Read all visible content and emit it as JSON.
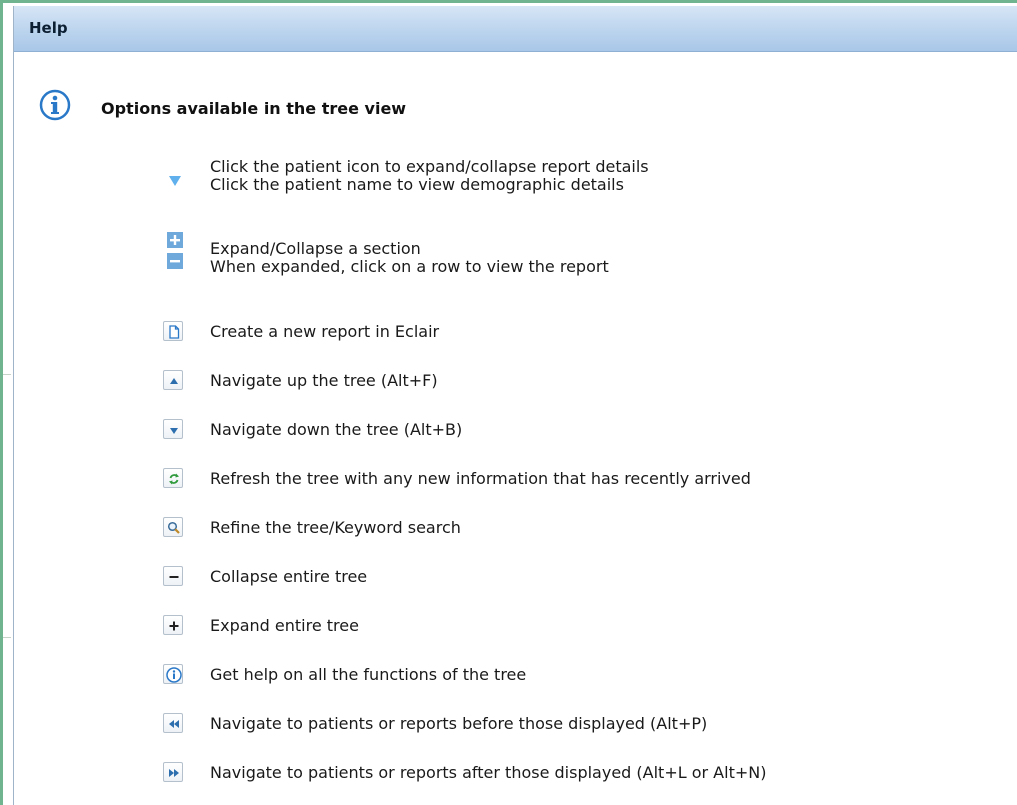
{
  "panel": {
    "title": "Help",
    "heading": "Options available in the tree view"
  },
  "patient": {
    "line1": "Click the patient icon to expand/collapse report details",
    "line2": "Click the patient name to view demographic details"
  },
  "section": {
    "line1": "Expand/Collapse a section",
    "line2": "When expanded, click on a row to view the report"
  },
  "items": [
    {
      "icon": "new-report-icon",
      "text": "Create a new report in Eclair"
    },
    {
      "icon": "navigate-up-icon",
      "text": "Navigate up the tree (Alt+F)"
    },
    {
      "icon": "navigate-down-icon",
      "text": "Navigate down the tree (Alt+B)"
    },
    {
      "icon": "refresh-icon",
      "text": "Refresh the tree with any new information that has recently arrived"
    },
    {
      "icon": "search-icon",
      "text": "Refine the tree/Keyword search"
    },
    {
      "icon": "collapse-all-icon",
      "text": "Collapse entire tree"
    },
    {
      "icon": "expand-all-icon",
      "text": "Expand entire tree"
    },
    {
      "icon": "info-icon",
      "text": "Get help on all the functions of the tree"
    },
    {
      "icon": "previous-page-icon",
      "text": "Navigate to patients or reports before those displayed (Alt+P)"
    },
    {
      "icon": "next-page-icon",
      "text": "Navigate to patients or reports after those displayed (Alt+L or Alt+N)"
    }
  ],
  "colors": {
    "titlebar": "#b9d3ee",
    "frame_border": "#6fb38f",
    "icon_blue": "#2a78c8"
  }
}
